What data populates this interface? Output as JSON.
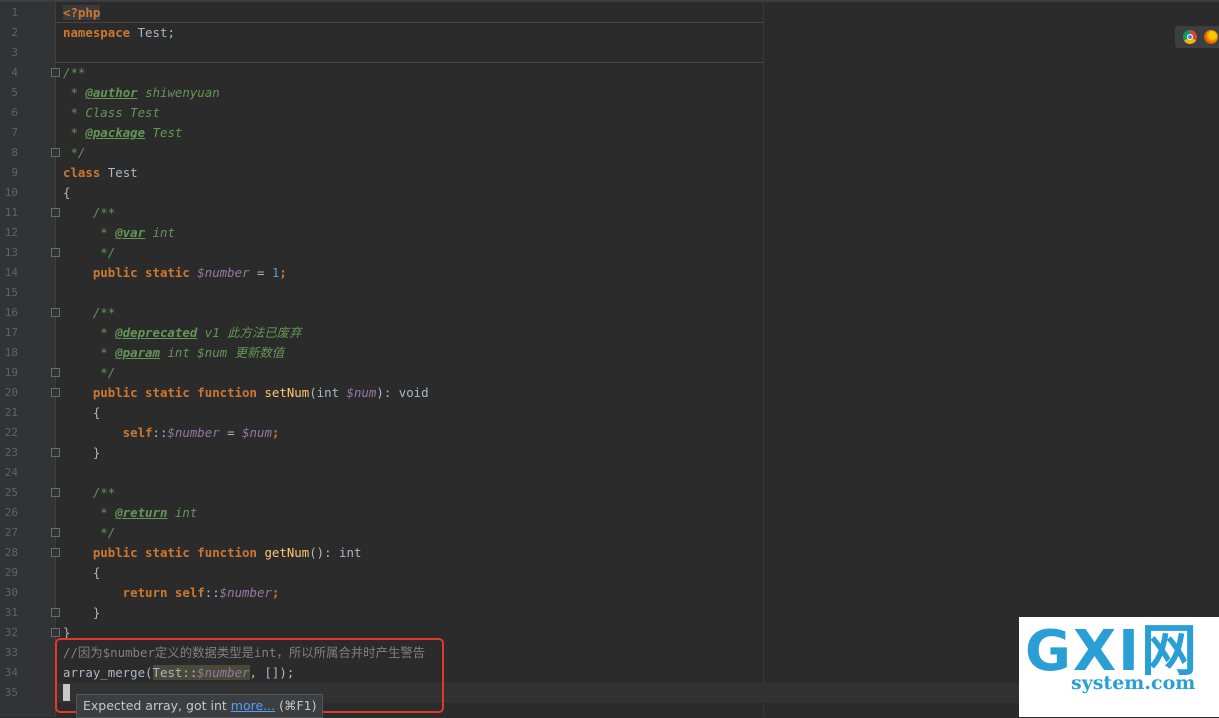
{
  "editor": {
    "line_numbers": [
      "1",
      "2",
      "3",
      "4",
      "5",
      "6",
      "7",
      "8",
      "9",
      "10",
      "11",
      "12",
      "13",
      "14",
      "15",
      "16",
      "17",
      "18",
      "19",
      "20",
      "21",
      "22",
      "23",
      "24",
      "25",
      "26",
      "27",
      "28",
      "29",
      "30",
      "31",
      "32",
      "33",
      "34",
      "35"
    ],
    "lines": [
      [
        {
          "t": "<?php",
          "c": "kw php"
        }
      ],
      [
        {
          "t": "namespace",
          "c": "kw"
        },
        {
          "t": " Test;",
          "c": "cls"
        }
      ],
      [],
      [
        {
          "t": "/**",
          "c": "doc"
        }
      ],
      [
        {
          "t": " * ",
          "c": "doc"
        },
        {
          "t": "@author",
          "c": "tag"
        },
        {
          "t": " shiwenyuan",
          "c": "doc"
        }
      ],
      [
        {
          "t": " * Class Test",
          "c": "doc"
        }
      ],
      [
        {
          "t": " * ",
          "c": "doc"
        },
        {
          "t": "@package",
          "c": "tag"
        },
        {
          "t": " Test",
          "c": "doc"
        }
      ],
      [
        {
          "t": " */",
          "c": "doc"
        }
      ],
      [
        {
          "t": "class",
          "c": "kw"
        },
        {
          "t": " Test",
          "c": "cls"
        }
      ],
      [
        {
          "t": "{",
          "c": "cls"
        }
      ],
      [
        {
          "t": "    /**",
          "c": "doc"
        }
      ],
      [
        {
          "t": "     * ",
          "c": "doc"
        },
        {
          "t": "@var",
          "c": "tag"
        },
        {
          "t": " int",
          "c": "doc"
        }
      ],
      [
        {
          "t": "     */",
          "c": "doc"
        }
      ],
      [
        {
          "t": "    public static",
          "c": "kw"
        },
        {
          "t": " ",
          "c": "cls"
        },
        {
          "t": "$number",
          "c": "var"
        },
        {
          "t": " = ",
          "c": "cls"
        },
        {
          "t": "1",
          "c": "num"
        },
        {
          "t": ";",
          "c": "kw"
        }
      ],
      [],
      [
        {
          "t": "    /**",
          "c": "doc"
        }
      ],
      [
        {
          "t": "     * ",
          "c": "doc"
        },
        {
          "t": "@deprecated",
          "c": "tag"
        },
        {
          "t": " v1 此方法已废弃",
          "c": "doc"
        }
      ],
      [
        {
          "t": "     * ",
          "c": "doc"
        },
        {
          "t": "@param",
          "c": "tag"
        },
        {
          "t": " int $num 更新数值",
          "c": "doc"
        }
      ],
      [
        {
          "t": "     */",
          "c": "doc"
        }
      ],
      [
        {
          "t": "    public static function",
          "c": "kw"
        },
        {
          "t": " ",
          "c": "cls"
        },
        {
          "t": "setNum",
          "c": "fn"
        },
        {
          "t": "(int ",
          "c": "cls"
        },
        {
          "t": "$num",
          "c": "var"
        },
        {
          "t": "): void",
          "c": "cls"
        }
      ],
      [
        {
          "t": "    {",
          "c": "cls"
        }
      ],
      [
        {
          "t": "        self",
          "c": "kw"
        },
        {
          "t": "::",
          "c": "cls"
        },
        {
          "t": "$number",
          "c": "var"
        },
        {
          "t": " = ",
          "c": "cls"
        },
        {
          "t": "$num",
          "c": "var"
        },
        {
          "t": ";",
          "c": "kw"
        }
      ],
      [
        {
          "t": "    }",
          "c": "cls"
        }
      ],
      [],
      [
        {
          "t": "    /**",
          "c": "doc"
        }
      ],
      [
        {
          "t": "     * ",
          "c": "doc"
        },
        {
          "t": "@return",
          "c": "tag"
        },
        {
          "t": " int",
          "c": "doc"
        }
      ],
      [
        {
          "t": "     */",
          "c": "doc"
        }
      ],
      [
        {
          "t": "    public static function",
          "c": "kw"
        },
        {
          "t": " ",
          "c": "cls"
        },
        {
          "t": "getNum",
          "c": "fn"
        },
        {
          "t": "(): int",
          "c": "cls"
        }
      ],
      [
        {
          "t": "    {",
          "c": "cls"
        }
      ],
      [
        {
          "t": "        return self",
          "c": "kw"
        },
        {
          "t": "::",
          "c": "cls"
        },
        {
          "t": "$number",
          "c": "var"
        },
        {
          "t": ";",
          "c": "kw"
        }
      ],
      [
        {
          "t": "    }",
          "c": "cls"
        }
      ],
      [
        {
          "t": "}",
          "c": "cls"
        }
      ],
      [
        {
          "t": "//因为$number定义的数据类型是int，所以所属合并时产生警告",
          "c": "cmt"
        }
      ],
      [
        {
          "t": "array_merge(",
          "c": "cls"
        },
        {
          "t": "Test::",
          "c": "cls hl"
        },
        {
          "t": "$number",
          "c": "var hl"
        },
        {
          "t": ", []);",
          "c": "cls"
        }
      ],
      []
    ],
    "fold_lines": [
      4,
      8,
      11,
      13,
      16,
      19,
      20,
      23,
      25,
      27,
      28,
      31,
      32
    ]
  },
  "tooltip": {
    "message": "Expected array, got int",
    "link": "more...",
    "shortcut": "(⌘F1)"
  },
  "browser_icons": [
    "chrome-icon",
    "firefox-icon"
  ],
  "watermark": {
    "main": "GXI网",
    "sub": "system.com"
  }
}
